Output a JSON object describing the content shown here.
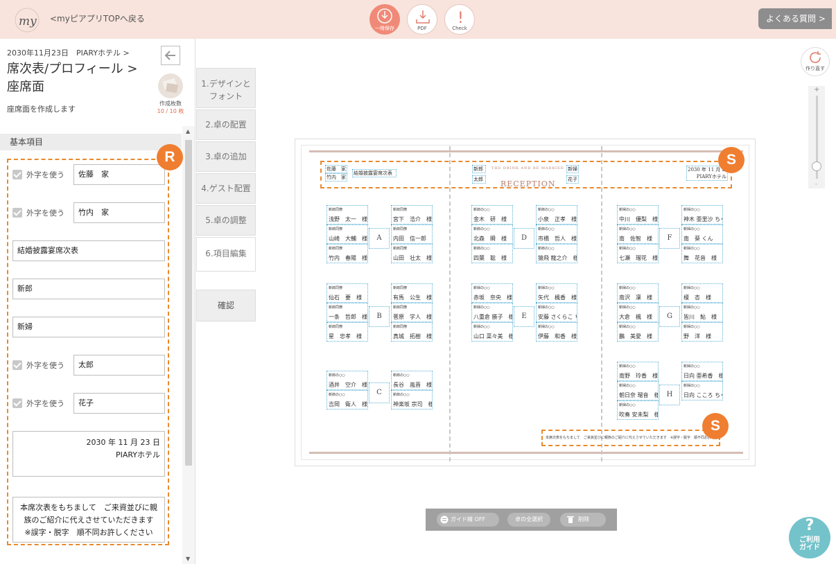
{
  "topbar": {
    "logo_text": "my",
    "back_link": "<myピアプリTOPへ戻る",
    "save_label": "一時保存",
    "pdf_label": "PDF",
    "check_label": "Check",
    "faq_label": "よくある質問 >"
  },
  "left_panel": {
    "date_venue": "2030年11月23日　PIARYホテル >",
    "title_line1": "席次表/プロフィール >",
    "title_line2": "座席面",
    "description": "座席面を作成します",
    "count_label": "作成枚数",
    "count_value": "10 / 10 枚",
    "section_title": "基本項目",
    "gaiji_label": "外字を使う",
    "fields": {
      "groom_family": "佐藤　家",
      "bride_family": "竹内　家",
      "title": "結婚披露宴席次表",
      "groom_label": "新郎",
      "bride_label": "新婦",
      "groom_name": "太郎",
      "bride_name": "花子",
      "date_line": "2030 年 11 月 23 日",
      "venue_line": "PIARYホテル",
      "footer_text": "本席次表をもちまして　ご来資並びに親族のご紹介に代えさせていただきます　※誤字・脱字　順不同お許しください"
    }
  },
  "badges": {
    "r": "R",
    "s": "S"
  },
  "steps": [
    {
      "label": "1.デザインと\nフォント"
    },
    {
      "label": "2.卓の配置"
    },
    {
      "label": "3.卓の追加"
    },
    {
      "label": "4.ゲスト配置"
    },
    {
      "label": "5.卓の調整"
    },
    {
      "label": "6.項目編集"
    }
  ],
  "confirm_label": "確認",
  "redo_label": "作り直す",
  "zoom": {
    "plus": "+",
    "minus": "-",
    "level": 0.15
  },
  "sheet": {
    "header": {
      "family_groom": "佐藤　家",
      "family_bride": "竹内　家",
      "title": "結婚披露宴席次表",
      "groom_label": "新郎",
      "groom_name": "太郎",
      "bride_label": "新婦",
      "bride_name": "花子",
      "crest": "THE DRINK AND BE MARRIED",
      "reception": "RECEPTION",
      "date": "2030 年 11 月 23 日",
      "venue": "PIARYホテル"
    },
    "footer": "本席次表をもちまして　ご来資並びに親族のご紹介に代えさせていただきます　※誤字・脱字　順不同お許しください",
    "tables": [
      {
        "id": "A",
        "seats": [
          {
            "r": "新郎同僚",
            "n": "浅野　太一　様"
          },
          {
            "r": "新郎同僚",
            "n": "山崎　大輔　様"
          },
          {
            "r": "新郎同僚",
            "n": "竹内　春陽　様"
          },
          {
            "r": "新郎同僚",
            "n": "宮下　浩介　様"
          },
          {
            "r": "新郎同僚",
            "n": "内田　信一郎　様"
          },
          {
            "r": "新郎同僚",
            "n": "山田　壮太　様"
          }
        ]
      },
      {
        "id": "B",
        "seats": [
          {
            "r": "新郎同僚",
            "n": "仙石　要　様"
          },
          {
            "r": "新郎同僚",
            "n": "一条　哲郎　様"
          },
          {
            "r": "新郎同僚",
            "n": "星　忠孝　様"
          },
          {
            "r": "新郎同僚",
            "n": "有馬　公生　様"
          },
          {
            "r": "新郎同僚",
            "n": "菅原　学人　様"
          },
          {
            "r": "新郎同僚",
            "n": "真城　拓樹　様"
          }
        ]
      },
      {
        "id": "C",
        "seats": [
          {
            "r": "新郎の○○",
            "n": "酒井　空介　様"
          },
          {
            "r": "新郎の○○",
            "n": "吉岡　衛人　様"
          },
          {
            "r": "新郎の○○",
            "n": "長谷　嵐晋　様"
          },
          {
            "r": "新郎の○○",
            "n": "神楽坂 宗司　様"
          }
        ]
      },
      {
        "id": "D",
        "seats": [
          {
            "r": "新郎の○○",
            "n": "金木　研　様"
          },
          {
            "r": "新郎の○○",
            "n": "北森　瞬　様"
          },
          {
            "r": "新郎の○○",
            "n": "四葉　聡　様"
          },
          {
            "r": "新郎の○○",
            "n": "小泉　正孝　様"
          },
          {
            "r": "新郎の○○",
            "n": "市橋　哲人　様"
          },
          {
            "r": "新郎の○○",
            "n": "猿飛 龍之介　様"
          }
        ]
      },
      {
        "id": "E",
        "seats": [
          {
            "r": "新婦の○○",
            "n": "赤坂　奈央　様"
          },
          {
            "r": "新婦の○○",
            "n": "八重倉 勝子　様"
          },
          {
            "r": "新婦の○○",
            "n": "山口 菜々美　様"
          },
          {
            "r": "新婦の○○",
            "n": "矢代　楓香　様"
          },
          {
            "r": "新婦の○○",
            "n": "安藤 さくらこ ちゃん"
          },
          {
            "r": "新婦の○○",
            "n": "伊藤　和香　様"
          }
        ]
      },
      {
        "id": "F",
        "seats": [
          {
            "r": "新婦の○○",
            "n": "中川　優梨　様"
          },
          {
            "r": "新婦の○○",
            "n": "南　佐智　様"
          },
          {
            "r": "新婦の○○",
            "n": "七瀬　瑠花　様"
          },
          {
            "r": "新婦の○○",
            "n": "神木 亜里沙 ちゃん"
          },
          {
            "r": "新婦の○○",
            "n": "南　葵 くん"
          },
          {
            "r": "新婦の○○",
            "n": "舞　花音　様"
          }
        ]
      },
      {
        "id": "G",
        "seats": [
          {
            "r": "新婦の○○",
            "n": "南沢　凜　様"
          },
          {
            "r": "新婦の○○",
            "n": "大倉　楓　様"
          },
          {
            "r": "新婦の○○",
            "n": "鵬　美愛　様"
          },
          {
            "r": "新婦の○○",
            "n": "榎　杏　様"
          },
          {
            "r": "新婦の○○",
            "n": "皆川　鮎　様"
          },
          {
            "r": "新婦の○○",
            "n": "野　洋　様"
          }
        ]
      },
      {
        "id": "H",
        "seats": [
          {
            "r": "新婦の○○",
            "n": "南野　玲香　様"
          },
          {
            "r": "新婦の○○",
            "n": "朝日奈 瑠音　様"
          },
          {
            "r": "新婦の○○",
            "n": "吹奏 安未梨　様"
          },
          {
            "r": "新婦の○○",
            "n": "日向 亜希香　様"
          },
          {
            "r": "新婦の○○",
            "n": "日向 こころ ちゃん"
          }
        ]
      }
    ]
  },
  "bottombar": {
    "guide_toggle": "ガイド線 OFF",
    "select_all": "卓の全選択",
    "delete": "削除"
  },
  "help_guide": {
    "q": "?",
    "label": "ご利用\nガイド"
  }
}
